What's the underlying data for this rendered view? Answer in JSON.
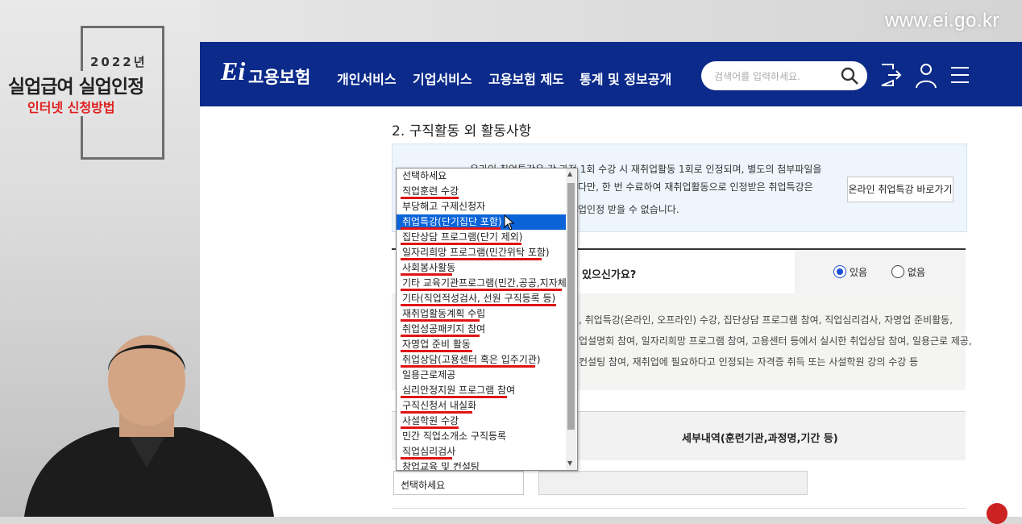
{
  "watermark_url": "www.ei.go.kr",
  "overlay": {
    "year": "2022년",
    "title": "실업급여 실업인정",
    "subtitle": "인터넷 신청방법"
  },
  "header": {
    "logo_text": "고용보험",
    "nav": [
      "개인서비스",
      "기업서비스",
      "고용보험 제도",
      "통계 및 정보공개"
    ],
    "search_placeholder": "검색어를 입력하세요."
  },
  "section": {
    "title": "2. 구직활동 외 활동사항"
  },
  "info": {
    "lines": [
      "온라인 취업특강은 강 과정 1회 수강 시 재취업활동 1회로 인정되며, 별도의 첨부파일을",
      "다만, 한 번 수료하여 재취업활동으로 인정받은 취업특강은",
      "업인정 받을 수 없습니다."
    ],
    "shortcut_button": "온라인 취업특강 바로가기"
  },
  "question": {
    "text": "있으신가요?",
    "options": [
      "있음",
      "없음"
    ],
    "selected": "있음"
  },
  "description": {
    "lines": [
      ", 취업특강(온라인, 오프라인) 수강, 집단상담 프로그램 참여, 직업심리검사, 자영업 준비활동,",
      "업설명회 참여, 일자리희망 프로그램 참여, 고용센터 등에서 실시한 취업상담 참여, 일용근로 제공,",
      "컨설팅 참여, 재취업에 필요하다고 인정되는 자격증 취득 또는 사설학원 강의 수강 등"
    ]
  },
  "table": {
    "detail_header": "세부내역(훈련기관,과정명,기간 등)",
    "select_value": "선택하세요"
  },
  "dropdown": {
    "selected_index": 3,
    "items": [
      "선택하세요",
      "직업훈련 수강",
      "부당해고 구제신청자",
      "취업특강(단기집단 포함)",
      "집단상담 프로그램(단기 제외)",
      "일자리희망 프로그램(민간위탁 포함)",
      "사회봉사활동",
      "기타 교육기관프로그램(민간,공공,지자체)",
      "기타(직업적성검사, 선원 구직등록 등)",
      "재취업활동계획 수립",
      "취업성공패키지 참여",
      "자영업 준비 활동",
      "취업상담(고용센터 혹은 입주기관)",
      "일용근로제공",
      "심리안정지원 프로그램 참여",
      "구직신청서 내실화",
      "사설학원 수강",
      "민간 직업소개소 구직등록",
      "직업심리검사",
      "창업교육 및 컨설팅"
    ],
    "underlined_indices": [
      1,
      3,
      4,
      5,
      6,
      7,
      8,
      9,
      10,
      11,
      12,
      14,
      15,
      16,
      18,
      19
    ]
  },
  "colors": {
    "header_bg": "#0b2a8a",
    "selection": "#0a64d8",
    "underline": "#e01414",
    "radio_on": "#1a4fd6"
  }
}
